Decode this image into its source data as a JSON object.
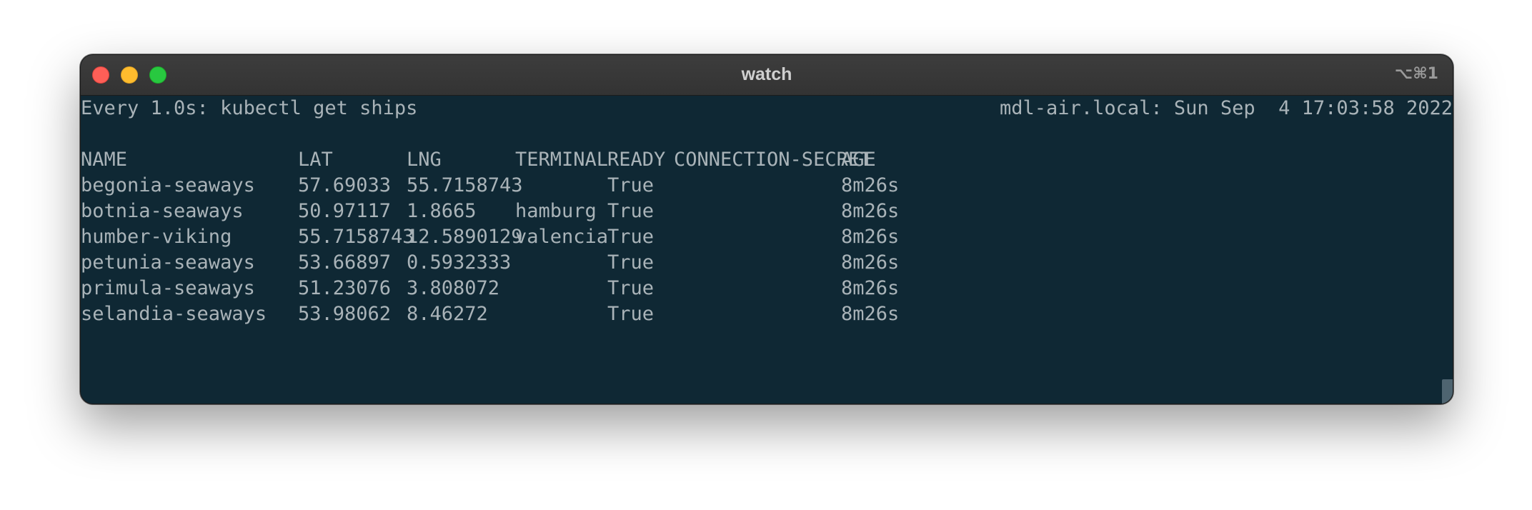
{
  "window": {
    "title": "watch",
    "shortcut": "⌥⌘1"
  },
  "watch": {
    "command": "Every 1.0s: kubectl get ships",
    "host_time": "mdl-air.local: Sun Sep  4 17:03:58 2022"
  },
  "table": {
    "columns": [
      "NAME",
      "LAT",
      "LNG",
      "TERMINAL",
      "READY",
      "CONNECTION-SECRET",
      "AGE"
    ],
    "rows": [
      [
        "begonia-seaways",
        "57.69033",
        "55.7158743",
        "",
        "True",
        "",
        "8m26s"
      ],
      [
        "botnia-seaways",
        "50.97117",
        "1.8665",
        "hamburg",
        "True",
        "",
        "8m26s"
      ],
      [
        "humber-viking",
        "55.7158743",
        "12.5890129",
        "valencia",
        "True",
        "",
        "8m26s"
      ],
      [
        "petunia-seaways",
        "53.66897",
        "0.5932333",
        "",
        "True",
        "",
        "8m26s"
      ],
      [
        "primula-seaways",
        "51.23076",
        "3.808072",
        "",
        "True",
        "",
        "8m26s"
      ],
      [
        "selandia-seaways",
        "53.98062",
        "8.46272",
        "",
        "True",
        "",
        "8m26s"
      ]
    ]
  }
}
